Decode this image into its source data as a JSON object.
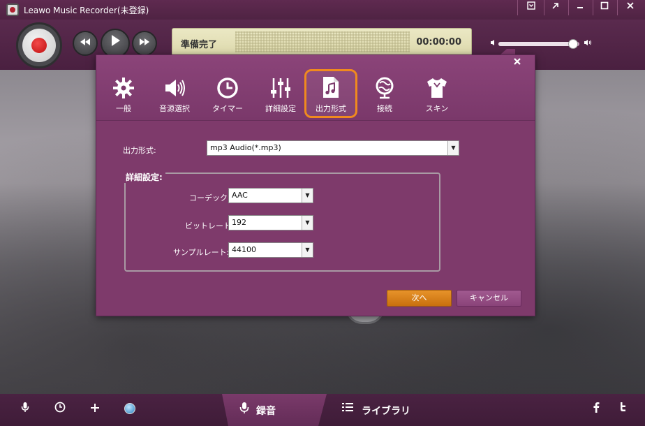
{
  "app": {
    "title": "Leawo Music Recorder(未登録)"
  },
  "window_controls": [
    "menu-icon",
    "share-icon",
    "minimize-icon",
    "maximize-icon",
    "close-icon"
  ],
  "player": {
    "status": "準備完了",
    "time": "00:00:00",
    "volume_fraction": 0.92
  },
  "dialog": {
    "tabs": [
      {
        "label": "一般",
        "icon": "gear-icon"
      },
      {
        "label": "音源選択",
        "icon": "speaker-icon"
      },
      {
        "label": "タイマー",
        "icon": "clock-icon"
      },
      {
        "label": "詳細設定",
        "icon": "sliders-icon"
      },
      {
        "label": "出力形式",
        "icon": "music-file-icon",
        "active": true
      },
      {
        "label": "接続",
        "icon": "network-icon"
      },
      {
        "label": "スキン",
        "icon": "shirt-icon"
      }
    ],
    "output_format_label": "出力形式:",
    "output_format_value": "mp3 Audio(*.mp3)",
    "advanced_title": "詳細設定:",
    "codec_label": "コーデック:",
    "codec_value": "AAC",
    "bitrate_label": "ビットレート:",
    "bitrate_value": "192",
    "samplerate_label": "サンプルレート:",
    "samplerate_value": "44100",
    "next_label": "次へ",
    "cancel_label": "キャンセル"
  },
  "bottom_bar": {
    "record_tab": "録音",
    "library_tab": "ライブラリ"
  },
  "colors": {
    "accent": "#f08a1e",
    "dialog_bg": "#7e3a6b",
    "titlebar": "#5a2a4e"
  }
}
